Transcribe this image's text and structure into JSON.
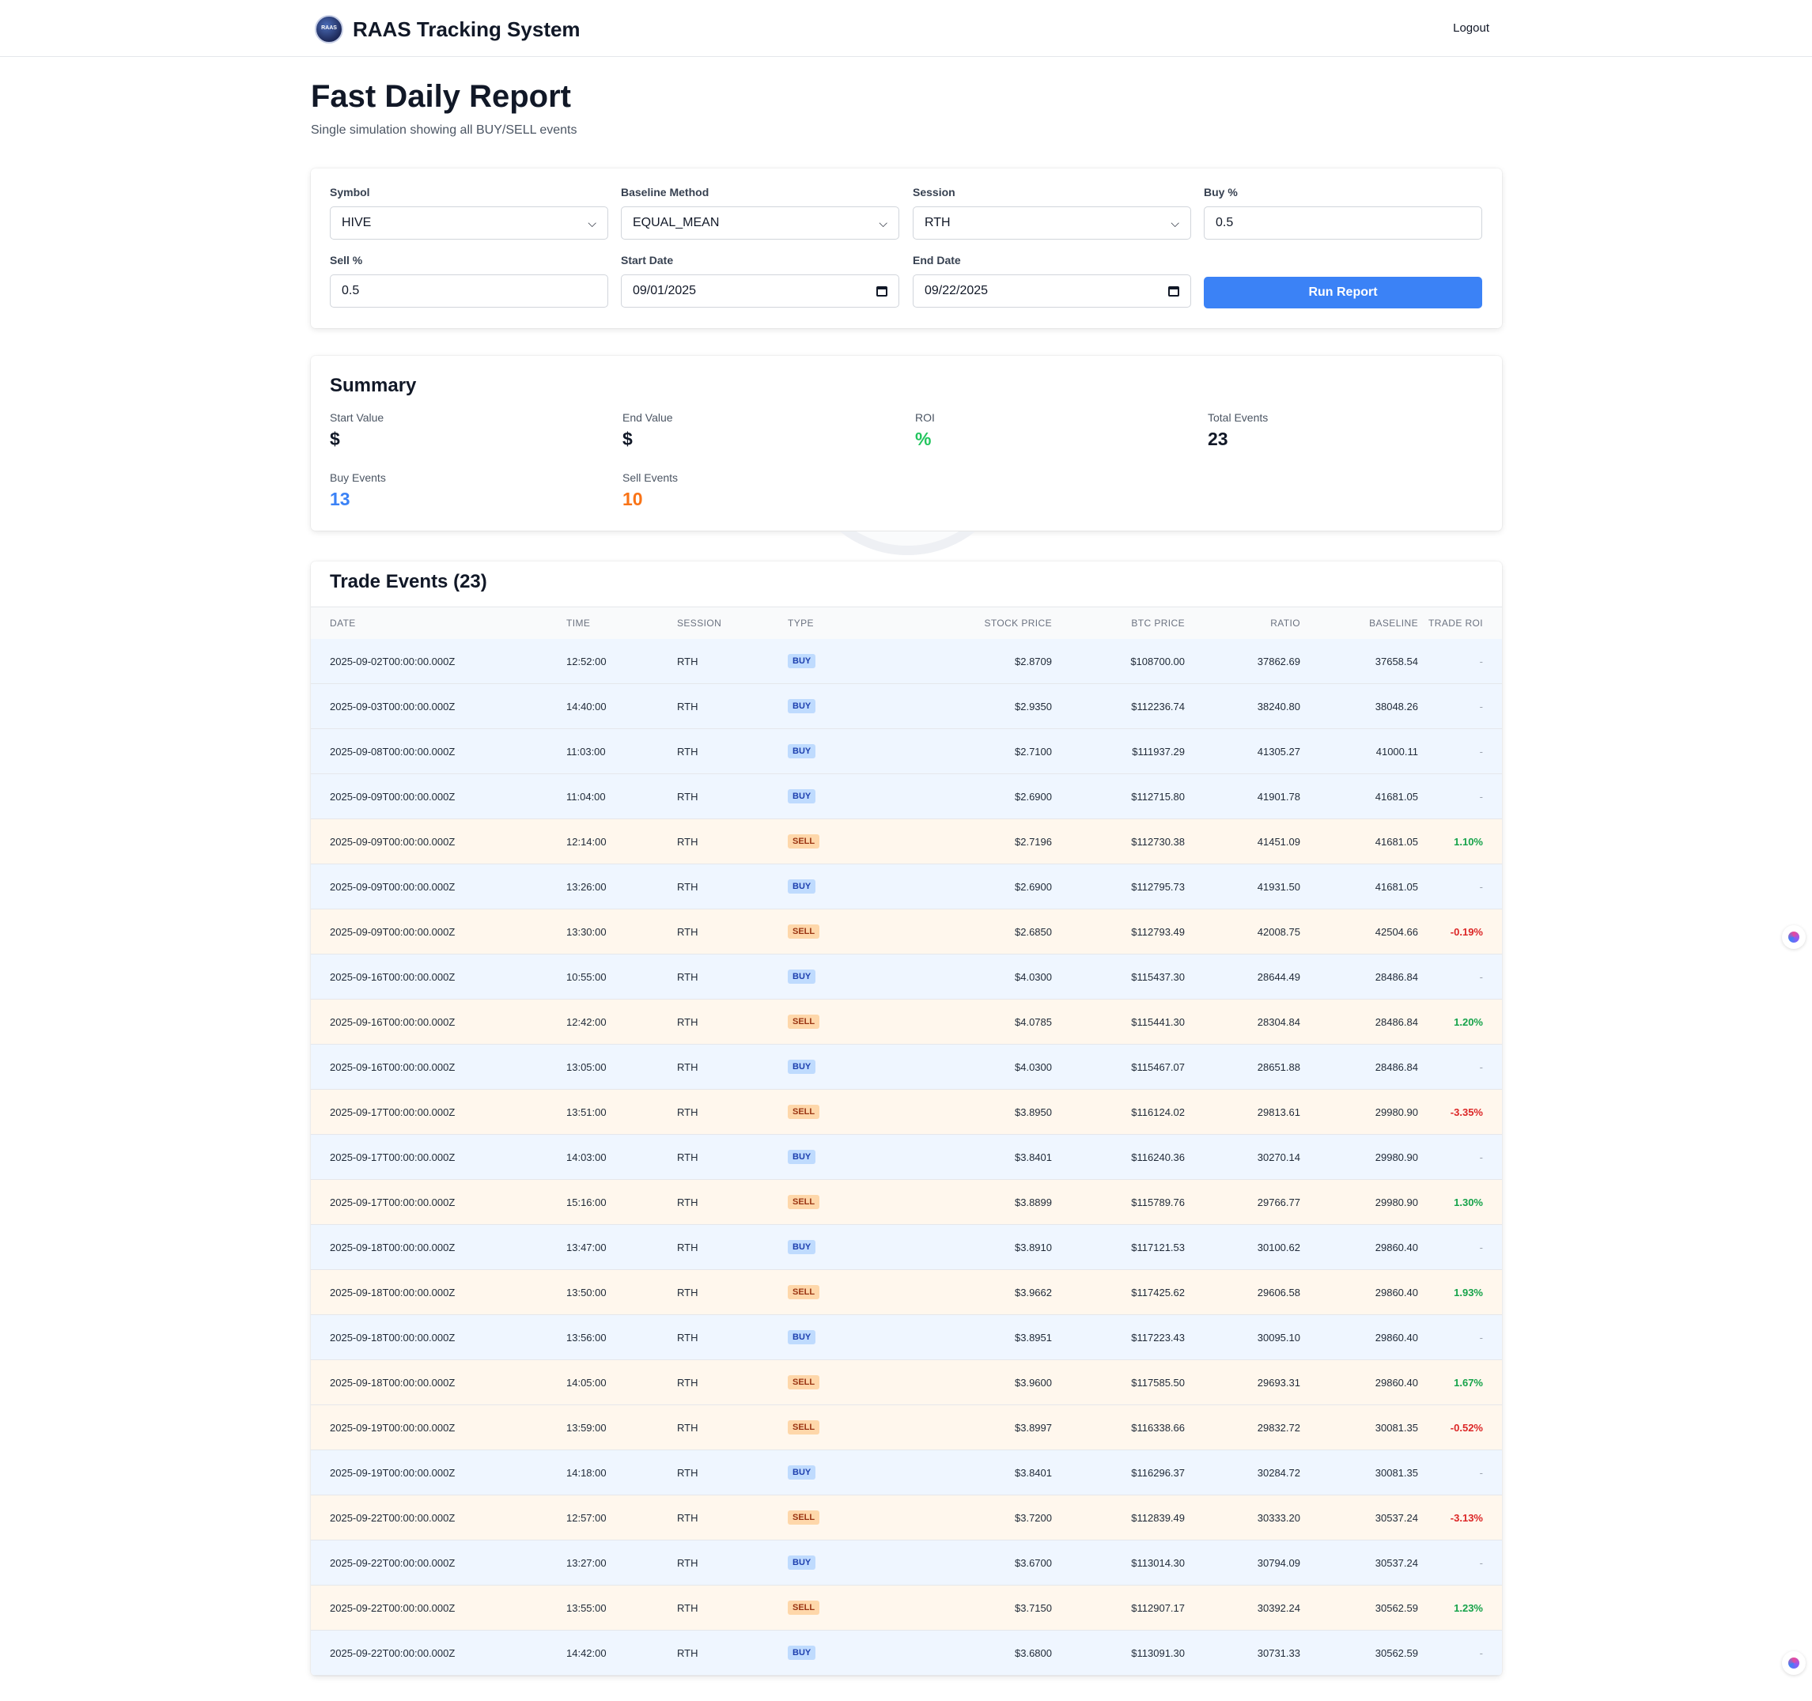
{
  "header": {
    "app_title": "RAAS Tracking System",
    "logo_text": "RAAS",
    "logout_label": "Logout"
  },
  "page": {
    "title": "Fast Daily Report",
    "subtitle": "Single simulation showing all BUY/SELL events"
  },
  "form": {
    "symbol": {
      "label": "Symbol",
      "value": "HIVE"
    },
    "baseline": {
      "label": "Baseline Method",
      "value": "EQUAL_MEAN"
    },
    "session": {
      "label": "Session",
      "value": "RTH"
    },
    "buy_pct": {
      "label": "Buy %",
      "value": "0.5"
    },
    "sell_pct": {
      "label": "Sell %",
      "value": "0.5"
    },
    "start_date": {
      "label": "Start Date",
      "value": "09/01/2025"
    },
    "end_date": {
      "label": "End Date",
      "value": "09/22/2025"
    },
    "run_label": "Run Report"
  },
  "summary": {
    "title": "Summary",
    "start_value": {
      "label": "Start Value",
      "value": "$"
    },
    "end_value": {
      "label": "End Value",
      "value": "$"
    },
    "roi": {
      "label": "ROI",
      "value": "%"
    },
    "total_events": {
      "label": "Total Events",
      "value": "23"
    },
    "buy_events": {
      "label": "Buy Events",
      "value": "13"
    },
    "sell_events": {
      "label": "Sell Events",
      "value": "10"
    }
  },
  "colors": {
    "accent": "#3b82f6",
    "buy": "#3b82f6",
    "sell": "#f97316",
    "positive": "#16a34a",
    "negative": "#dc2626"
  },
  "events": {
    "title": "Trade Events (23)",
    "columns": [
      "DATE",
      "TIME",
      "SESSION",
      "TYPE",
      "STOCK PRICE",
      "BTC PRICE",
      "RATIO",
      "BASELINE",
      "TRADE ROI"
    ],
    "rows": [
      [
        "2025-09-02T00:00:00.000Z",
        "12:52:00",
        "RTH",
        "BUY",
        "$2.8709",
        "$108700.00",
        "37862.69",
        "37658.54",
        "-"
      ],
      [
        "2025-09-03T00:00:00.000Z",
        "14:40:00",
        "RTH",
        "BUY",
        "$2.9350",
        "$112236.74",
        "38240.80",
        "38048.26",
        "-"
      ],
      [
        "2025-09-08T00:00:00.000Z",
        "11:03:00",
        "RTH",
        "BUY",
        "$2.7100",
        "$111937.29",
        "41305.27",
        "41000.11",
        "-"
      ],
      [
        "2025-09-09T00:00:00.000Z",
        "11:04:00",
        "RTH",
        "BUY",
        "$2.6900",
        "$112715.80",
        "41901.78",
        "41681.05",
        "-"
      ],
      [
        "2025-09-09T00:00:00.000Z",
        "12:14:00",
        "RTH",
        "SELL",
        "$2.7196",
        "$112730.38",
        "41451.09",
        "41681.05",
        "1.10%"
      ],
      [
        "2025-09-09T00:00:00.000Z",
        "13:26:00",
        "RTH",
        "BUY",
        "$2.6900",
        "$112795.73",
        "41931.50",
        "41681.05",
        "-"
      ],
      [
        "2025-09-09T00:00:00.000Z",
        "13:30:00",
        "RTH",
        "SELL",
        "$2.6850",
        "$112793.49",
        "42008.75",
        "42504.66",
        "-0.19%"
      ],
      [
        "2025-09-16T00:00:00.000Z",
        "10:55:00",
        "RTH",
        "BUY",
        "$4.0300",
        "$115437.30",
        "28644.49",
        "28486.84",
        "-"
      ],
      [
        "2025-09-16T00:00:00.000Z",
        "12:42:00",
        "RTH",
        "SELL",
        "$4.0785",
        "$115441.30",
        "28304.84",
        "28486.84",
        "1.20%"
      ],
      [
        "2025-09-16T00:00:00.000Z",
        "13:05:00",
        "RTH",
        "BUY",
        "$4.0300",
        "$115467.07",
        "28651.88",
        "28486.84",
        "-"
      ],
      [
        "2025-09-17T00:00:00.000Z",
        "13:51:00",
        "RTH",
        "SELL",
        "$3.8950",
        "$116124.02",
        "29813.61",
        "29980.90",
        "-3.35%"
      ],
      [
        "2025-09-17T00:00:00.000Z",
        "14:03:00",
        "RTH",
        "BUY",
        "$3.8401",
        "$116240.36",
        "30270.14",
        "29980.90",
        "-"
      ],
      [
        "2025-09-17T00:00:00.000Z",
        "15:16:00",
        "RTH",
        "SELL",
        "$3.8899",
        "$115789.76",
        "29766.77",
        "29980.90",
        "1.30%"
      ],
      [
        "2025-09-18T00:00:00.000Z",
        "13:47:00",
        "RTH",
        "BUY",
        "$3.8910",
        "$117121.53",
        "30100.62",
        "29860.40",
        "-"
      ],
      [
        "2025-09-18T00:00:00.000Z",
        "13:50:00",
        "RTH",
        "SELL",
        "$3.9662",
        "$117425.62",
        "29606.58",
        "29860.40",
        "1.93%"
      ],
      [
        "2025-09-18T00:00:00.000Z",
        "13:56:00",
        "RTH",
        "BUY",
        "$3.8951",
        "$117223.43",
        "30095.10",
        "29860.40",
        "-"
      ],
      [
        "2025-09-18T00:00:00.000Z",
        "14:05:00",
        "RTH",
        "SELL",
        "$3.9600",
        "$117585.50",
        "29693.31",
        "29860.40",
        "1.67%"
      ],
      [
        "2025-09-19T00:00:00.000Z",
        "13:59:00",
        "RTH",
        "SELL",
        "$3.8997",
        "$116338.66",
        "29832.72",
        "30081.35",
        "-0.52%"
      ],
      [
        "2025-09-19T00:00:00.000Z",
        "14:18:00",
        "RTH",
        "BUY",
        "$3.8401",
        "$116296.37",
        "30284.72",
        "30081.35",
        "-"
      ],
      [
        "2025-09-22T00:00:00.000Z",
        "12:57:00",
        "RTH",
        "SELL",
        "$3.7200",
        "$112839.49",
        "30333.20",
        "30537.24",
        "-3.13%"
      ],
      [
        "2025-09-22T00:00:00.000Z",
        "13:27:00",
        "RTH",
        "BUY",
        "$3.6700",
        "$113014.30",
        "30794.09",
        "30537.24",
        "-"
      ],
      [
        "2025-09-22T00:00:00.000Z",
        "13:55:00",
        "RTH",
        "SELL",
        "$3.7150",
        "$112907.17",
        "30392.24",
        "30562.59",
        "1.23%"
      ],
      [
        "2025-09-22T00:00:00.000Z",
        "14:42:00",
        "RTH",
        "BUY",
        "$3.6800",
        "$113091.30",
        "30731.33",
        "30562.59",
        "-"
      ]
    ]
  },
  "floating_icons": [
    "ai-assistant-icon",
    "ai-assistant-icon"
  ]
}
